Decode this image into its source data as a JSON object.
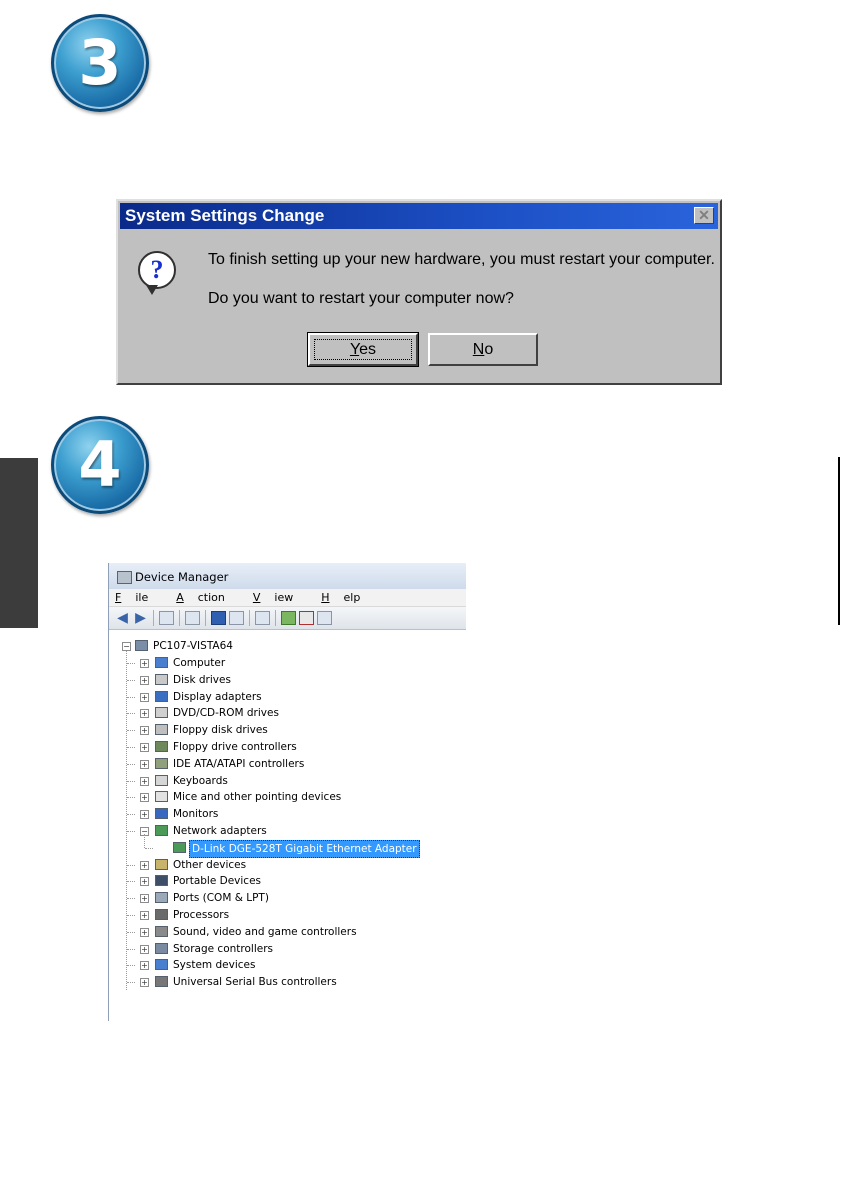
{
  "steps": {
    "step3": "3",
    "step4": "4"
  },
  "dialog": {
    "title": "System Settings Change",
    "close": "✕",
    "icon": "?",
    "message1": "To finish setting up your new hardware, you must restart your computer.",
    "message2": "Do you want to restart your computer now?",
    "yes_first": "Y",
    "yes_rest": "es",
    "no_first": "N",
    "no_rest": "o"
  },
  "device_manager": {
    "title": "Device Manager",
    "menu": [
      {
        "first": "F",
        "rest": "ile"
      },
      {
        "first": "A",
        "rest": "ction"
      },
      {
        "first": "V",
        "rest": "iew"
      },
      {
        "first": "H",
        "rest": "elp"
      }
    ],
    "root": "PC107-VISTA64",
    "items": [
      {
        "label": "Computer",
        "icon": "computer-icon",
        "color": "#4a7fcf"
      },
      {
        "label": "Disk drives",
        "icon": "disk-drive-icon",
        "color": "#c9c9c9"
      },
      {
        "label": "Display adapters",
        "icon": "display-adapter-icon",
        "color": "#3b6fc2"
      },
      {
        "label": "DVD/CD-ROM drives",
        "icon": "dvd-drive-icon",
        "color": "#d0d0d0"
      },
      {
        "label": "Floppy disk drives",
        "icon": "floppy-drive-icon",
        "color": "#bfbfbf"
      },
      {
        "label": "Floppy drive controllers",
        "icon": "floppy-controller-icon",
        "color": "#6e8a5c"
      },
      {
        "label": "IDE ATA/ATAPI controllers",
        "icon": "ide-controller-icon",
        "color": "#8fa07a"
      },
      {
        "label": "Keyboards",
        "icon": "keyboard-icon",
        "color": "#d6d6d6"
      },
      {
        "label": "Mice and other pointing devices",
        "icon": "mouse-icon",
        "color": "#e2e2e2"
      },
      {
        "label": "Monitors",
        "icon": "monitor-icon",
        "color": "#3868c0"
      },
      {
        "label": "Network adapters",
        "icon": "network-adapter-icon",
        "color": "#4c9a58"
      },
      {
        "label": "Other devices",
        "icon": "other-devices-icon",
        "color": "#c8b46a"
      },
      {
        "label": "Portable Devices",
        "icon": "portable-device-icon",
        "color": "#3d4e66"
      },
      {
        "label": "Ports (COM & LPT)",
        "icon": "port-icon",
        "color": "#9aa8b8"
      },
      {
        "label": "Processors",
        "icon": "processor-icon",
        "color": "#6a6a6a"
      },
      {
        "label": "Sound, video and game controllers",
        "icon": "sound-icon",
        "color": "#8a8a8a"
      },
      {
        "label": "Storage controllers",
        "icon": "storage-controller-icon",
        "color": "#7a8aa0"
      },
      {
        "label": "System devices",
        "icon": "system-devices-icon",
        "color": "#4a7fcf"
      },
      {
        "label": "Universal Serial Bus controllers",
        "icon": "usb-icon",
        "color": "#777777"
      }
    ],
    "selected_child": "D-Link DGE-528T Gigabit Ethernet Adapter",
    "expanded_index": 10
  }
}
